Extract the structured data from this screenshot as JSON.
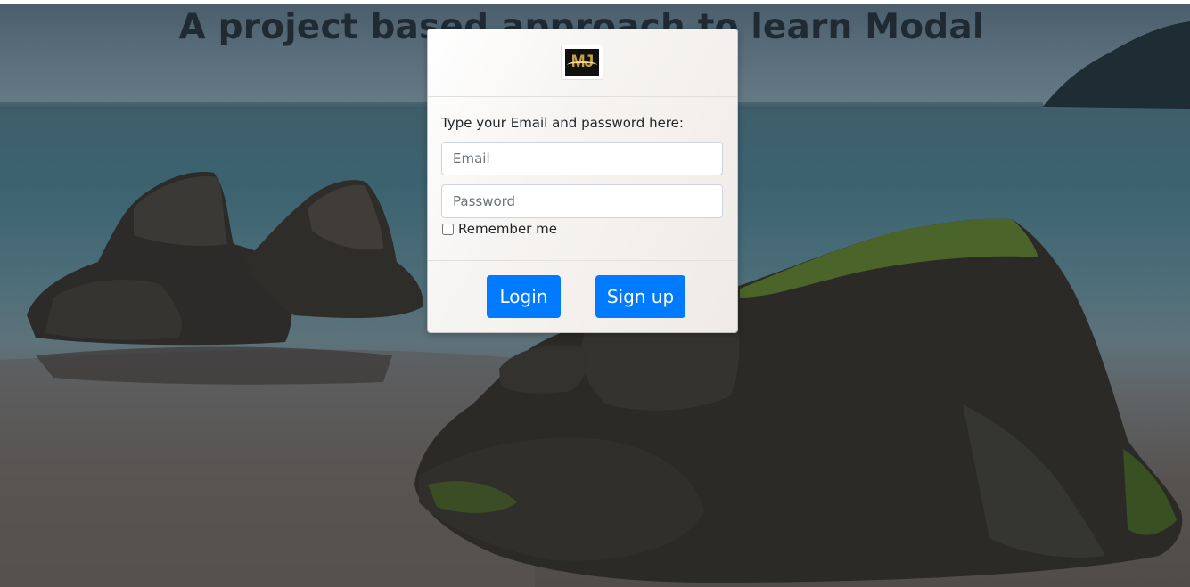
{
  "page": {
    "title": "A project based approach to learn Modal"
  },
  "modal": {
    "logo_text": "MJ",
    "instruction": "Type your Email and password here:",
    "email_placeholder": "Email",
    "password_placeholder": "Password",
    "remember_label": "Remember me",
    "remember_checked": false,
    "login_label": "Login",
    "signup_label": "Sign up"
  },
  "colors": {
    "primary_button": "#007bff",
    "title_text": "#1f2a33"
  }
}
